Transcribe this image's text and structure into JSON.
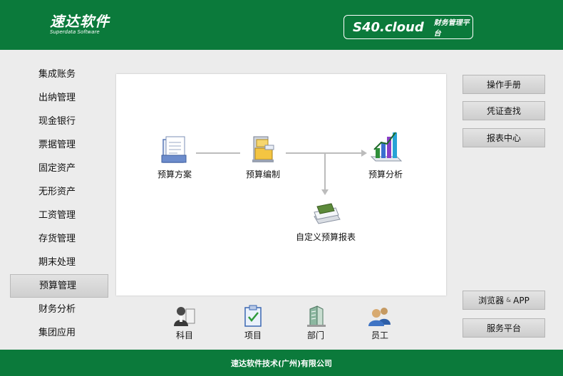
{
  "header": {
    "logo_cn": "速达软件",
    "logo_en": "Superdata Software",
    "product_name": "S40.cloud",
    "product_subtitle": "财务管理平台"
  },
  "sidebar": {
    "items": [
      {
        "label": "集成账务"
      },
      {
        "label": "出纳管理"
      },
      {
        "label": "现金银行"
      },
      {
        "label": "票据管理"
      },
      {
        "label": "固定资产"
      },
      {
        "label": "无形资产"
      },
      {
        "label": "工资管理"
      },
      {
        "label": "存货管理"
      },
      {
        "label": "期末处理"
      },
      {
        "label": "预算管理",
        "active": true
      },
      {
        "label": "财务分析"
      },
      {
        "label": "集团应用"
      }
    ]
  },
  "flow": {
    "nodes": [
      {
        "label": "预算方案",
        "icon": "document-folder-icon"
      },
      {
        "label": "预算编制",
        "icon": "file-cabinet-icon"
      },
      {
        "label": "预算分析",
        "icon": "bar-chart-icon"
      },
      {
        "label": "自定义预算报表",
        "icon": "report-stack-icon"
      }
    ]
  },
  "right_buttons": {
    "manual": "操作手册",
    "voucher": "凭证查找",
    "report_center": "报表中心",
    "browser_app_1": "浏览器",
    "browser_app_amp": "&",
    "browser_app_2": "APP",
    "service_platform": "服务平台"
  },
  "bottom_icons": [
    {
      "label": "科目",
      "icon": "person-book-icon"
    },
    {
      "label": "项目",
      "icon": "clipboard-check-icon"
    },
    {
      "label": "部门",
      "icon": "building-icon"
    },
    {
      "label": "员工",
      "icon": "employee-icon"
    }
  ],
  "footer": {
    "company": "速达软件技术(广州)有限公司"
  },
  "colors": {
    "brand_green": "#0b7a3b",
    "panel_bg": "#ececec",
    "connector": "#bcbcbc"
  }
}
